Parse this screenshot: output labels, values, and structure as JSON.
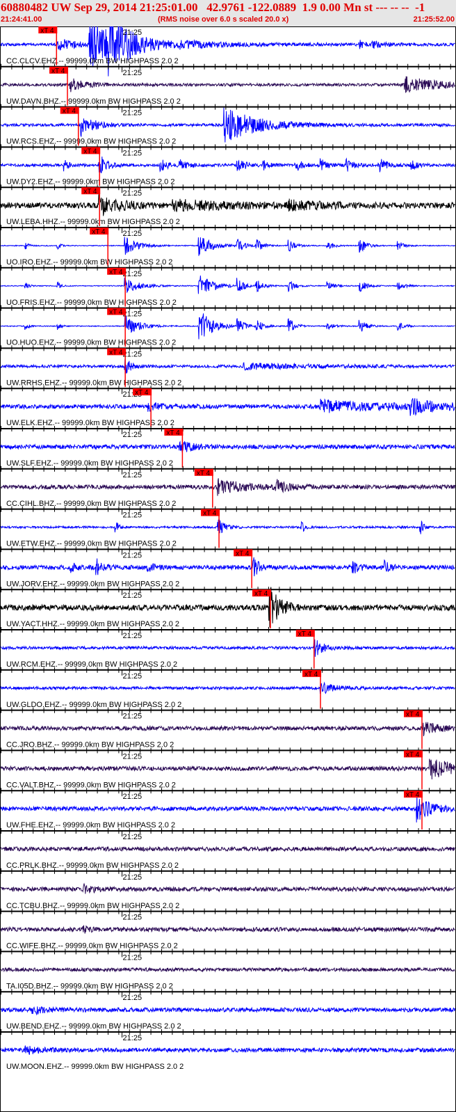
{
  "header": {
    "title": "60880482 UW Sep 29, 2014 21:25:01.00   42.9761 -122.0889  1.9 0.00 Mn st --- -- --  -1",
    "start_time": "21:24:41.00",
    "note": "(RMS noise over 6.0 s scaled 20.0 x)",
    "end_time": "21:25:52.00"
  },
  "chart_data": {
    "type": "line",
    "title": "Seismogram record section",
    "x_range_s": [
      0,
      71
    ],
    "x_start": "21:24:41.00",
    "x_end": "21:25:52.00",
    "minute_tick_label": "21:25",
    "minute_tick_s": 19,
    "pick_label": "xT 4",
    "colors": {
      "blue": "#0000ff",
      "purple": "#2a0a55",
      "black": "#000000",
      "pick": "#ff0000"
    },
    "traces": [
      {
        "label": "CC.CLCV.EHZ.-- 99999.0km BW  HIGHPASS  2.0  2",
        "color": "blue",
        "pick_s": 8.8,
        "noise": 2,
        "bursts": [
          [
            9,
            8,
            3
          ],
          [
            14,
            34,
            5
          ],
          [
            17,
            28,
            3
          ],
          [
            28,
            3,
            10
          ],
          [
            56,
            5,
            1
          ],
          [
            58,
            4,
            2
          ]
        ]
      },
      {
        "label": "UW.DAVN.BHZ.-- 99999.0km BW  HIGHPASS  2.0  2",
        "color": "purple",
        "pick_s": 10.5,
        "noise": 2,
        "bursts": [
          [
            11,
            10,
            2
          ],
          [
            63,
            11,
            6
          ]
        ]
      },
      {
        "label": "UW.RCS.EHZ.-- 99999.0km BW  HIGHPASS  2.0  2",
        "color": "blue",
        "pick_s": 12.2,
        "noise": 2,
        "bursts": [
          [
            12.5,
            16,
            2
          ],
          [
            35,
            24,
            5
          ]
        ]
      },
      {
        "label": "UW.DY2.EHZ.-- 99999.0km BW  HIGHPASS  2.0  2",
        "color": "blue",
        "pick_s": 15.5,
        "noise": 2,
        "bursts": [
          [
            10,
            8,
            0.6
          ],
          [
            15.5,
            16,
            1
          ],
          [
            25,
            9,
            1
          ],
          [
            28,
            8,
            1
          ],
          [
            37,
            12,
            1
          ],
          [
            41,
            6,
            1
          ],
          [
            46,
            9,
            1
          ],
          [
            50,
            8,
            1
          ],
          [
            54,
            8,
            1
          ],
          [
            59,
            11,
            1
          ],
          [
            64,
            6,
            1
          ]
        ]
      },
      {
        "label": "UW.LEBA.HHZ.-- 99999.0km BW  HIGHPASS  2.0  2",
        "color": "black",
        "pick_s": 15.5,
        "noise": 4,
        "bursts": [
          [
            15.5,
            14,
            3
          ],
          [
            27,
            6,
            10
          ],
          [
            45,
            5,
            5
          ]
        ]
      },
      {
        "label": "UO.IRO.EHZ.-- 99999.0km BW  HIGHPASS  2.0  2",
        "color": "blue",
        "pick_s": 16.8,
        "noise": 0.6,
        "bursts": [
          [
            4,
            5,
            0.5
          ],
          [
            9,
            5,
            0.5
          ],
          [
            19.5,
            13,
            2
          ],
          [
            31,
            15,
            2
          ],
          [
            37,
            10,
            1
          ],
          [
            40,
            8,
            1
          ],
          [
            45,
            8,
            1
          ],
          [
            51,
            6,
            1
          ],
          [
            56,
            11,
            1
          ],
          [
            62,
            6,
            1
          ]
        ]
      },
      {
        "label": "UO.FRIS.EHZ.-- 99999.0km BW  HIGHPASS  2.0  2",
        "color": "blue",
        "pick_s": 19.5,
        "noise": 0.6,
        "bursts": [
          [
            4,
            5,
            0.5
          ],
          [
            9,
            5,
            0.5
          ],
          [
            19.5,
            12,
            2
          ],
          [
            31,
            18,
            2
          ],
          [
            37,
            10,
            1
          ],
          [
            40,
            8,
            1
          ],
          [
            45,
            8,
            1
          ],
          [
            51,
            6,
            1
          ],
          [
            56,
            10,
            1
          ],
          [
            62,
            6,
            1
          ]
        ]
      },
      {
        "label": "UO.HUO.EHZ.-- 99999.0km BW  HIGHPASS  2.0  2",
        "color": "blue",
        "pick_s": 19.5,
        "noise": 0.6,
        "bursts": [
          [
            4,
            5,
            0.5
          ],
          [
            9,
            5,
            0.5
          ],
          [
            19.5,
            16,
            2
          ],
          [
            31,
            25,
            2
          ],
          [
            37,
            10,
            1
          ],
          [
            40,
            8,
            1
          ],
          [
            45,
            10,
            1
          ],
          [
            51,
            6,
            1
          ],
          [
            56,
            10,
            1
          ],
          [
            62,
            6,
            1
          ]
        ]
      },
      {
        "label": "UW.RRHS.EHZ.-- 99999.0km BW  HIGHPASS  2.0  2",
        "color": "blue",
        "pick_s": 19.5,
        "noise": 2,
        "bursts": [
          [
            19.5,
            12,
            1
          ],
          [
            38,
            4,
            10
          ]
        ]
      },
      {
        "label": "UW.ELK.EHZ.-- 99999.0km BW  HIGHPASS  2.0  2",
        "color": "blue",
        "pick_s": 23.5,
        "noise": 3,
        "bursts": [
          [
            23,
            5,
            2
          ],
          [
            50,
            8,
            10
          ],
          [
            64,
            9,
            4
          ]
        ]
      },
      {
        "label": "UW.SLF.EHZ.-- 99999.0km BW  HIGHPASS  2.0  2",
        "color": "blue",
        "pick_s": 28.4,
        "noise": 3,
        "bursts": [
          [
            28,
            8,
            2
          ]
        ]
      },
      {
        "label": "CC.CIHL.BHZ.-- 99999.0km BW  HIGHPASS  2.0  2",
        "color": "purple",
        "pick_s": 33.1,
        "noise": 3,
        "bursts": [
          [
            34,
            10,
            4
          ],
          [
            43,
            8,
            2
          ]
        ]
      },
      {
        "label": "UW.ETW.EHZ.-- 99999.0km BW  HIGHPASS  2.0  2",
        "color": "blue",
        "pick_s": 34.1,
        "noise": 1.5,
        "bursts": [
          [
            34,
            12,
            1
          ],
          [
            18,
            8,
            0.5
          ],
          [
            47,
            8,
            0.5
          ],
          [
            65.5,
            10,
            0.5
          ]
        ]
      },
      {
        "label": "UW.JORV.EHZ.-- 99999.0km BW  HIGHPASS  2.0  2",
        "color": "blue",
        "pick_s": 39.2,
        "noise": 3,
        "bursts": [
          [
            11,
            6,
            1
          ],
          [
            15,
            12,
            1
          ],
          [
            23,
            6,
            1
          ],
          [
            39.5,
            12,
            1
          ],
          [
            55,
            8,
            1
          ],
          [
            60,
            8,
            1
          ]
        ]
      },
      {
        "label": "UW.YACT.HHZ.-- 99999.0km BW  HIGHPASS  2.0  2",
        "color": "black",
        "pick_s": 42.1,
        "noise": 4,
        "bursts": [
          [
            42,
            30,
            1.5
          ]
        ]
      },
      {
        "label": "UW.RCM.EHZ.-- 99999.0km BW  HIGHPASS  2.0  2",
        "color": "blue",
        "pick_s": 48.9,
        "noise": 2,
        "bursts": [
          [
            49,
            12,
            1.5
          ]
        ]
      },
      {
        "label": "UW.GLDO.EHZ.-- 99999.0km BW  HIGHPASS  2.0  2",
        "color": "blue",
        "pick_s": 49.9,
        "noise": 2,
        "bursts": [
          [
            50,
            8,
            2
          ]
        ]
      },
      {
        "label": "CC.JRO.BHZ.-- 99999.0km BW  HIGHPASS  2.0  2",
        "color": "purple",
        "pick_s": 65.7,
        "noise": 3,
        "bursts": [
          [
            66,
            10,
            2
          ]
        ]
      },
      {
        "label": "CC.VALT.BHZ.-- 99999.0km BW  HIGHPASS  2.0  2",
        "color": "purple",
        "pick_s": 65.7,
        "noise": 3,
        "bursts": [
          [
            67,
            14,
            4
          ]
        ]
      },
      {
        "label": "UW.FHE.EHZ.-- 99999.0km BW  HIGHPASS  2.0  2",
        "color": "blue",
        "pick_s": 65.7,
        "noise": 3,
        "bursts": [
          [
            65,
            18,
            2
          ]
        ]
      },
      {
        "label": "CC.PRLK.BHZ.-- 99999.0km BW  HIGHPASS  2.0  2",
        "color": "purple",
        "noise": 3,
        "bursts": []
      },
      {
        "label": "CC.TCBU.BHZ.-- 99999.0km BW  HIGHPASS  2.0  2",
        "color": "purple",
        "noise": 3,
        "bursts": [
          [
            13,
            5,
            2
          ]
        ]
      },
      {
        "label": "CC.WIFE.BHZ.-- 99999.0km BW  HIGHPASS  2.0  2",
        "color": "purple",
        "noise": 3,
        "bursts": [
          [
            13,
            4,
            1
          ]
        ]
      },
      {
        "label": "TA.I05D.BHZ.-- 99999.0km BW  HIGHPASS  2.0  2",
        "color": "purple",
        "noise": 2.5,
        "bursts": []
      },
      {
        "label": "UW.BEND.EHZ.-- 99999.0km BW  HIGHPASS  2.0  2",
        "color": "blue",
        "noise": 3,
        "bursts": [
          [
            5,
            5,
            2
          ]
        ]
      },
      {
        "label": "UW.MOON.EHZ.-- 99999.0km BW  HIGHPASS  2.0  2",
        "color": "blue",
        "noise": 3,
        "bursts": [
          [
            4,
            5,
            2
          ]
        ]
      }
    ]
  }
}
